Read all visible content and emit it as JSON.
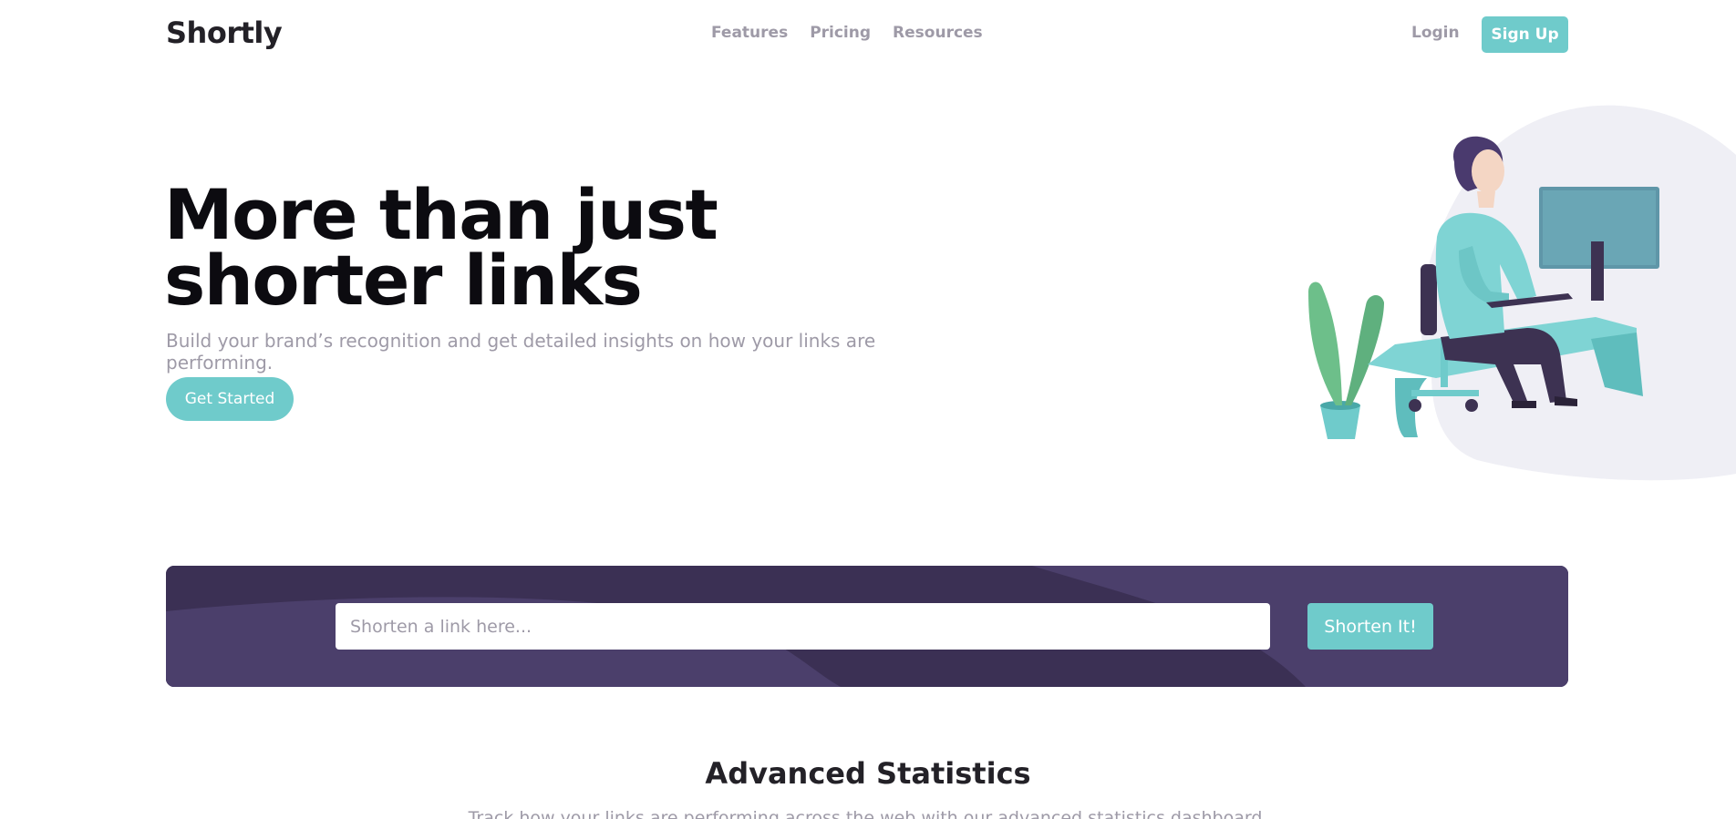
{
  "nav": {
    "logo": "Shortly",
    "links": [
      "Features",
      "Pricing",
      "Resources"
    ],
    "login": "Login",
    "signup": "Sign Up"
  },
  "hero": {
    "title": "More than just shorter links",
    "subtitle": "Build your brand’s recognition and get detailed insights on how your links are performing.",
    "cta": "Get Started"
  },
  "shorten": {
    "placeholder": "Shorten a link here...",
    "button": "Shorten It!"
  },
  "stats": {
    "title": "Advanced Statistics",
    "subtitle": "Track how your links are performing across the web with our advanced statistics dashboard."
  },
  "colors": {
    "accent": "#6fcbcb",
    "dark_violet": "#3b3054",
    "grayish": "#9e9aa7"
  }
}
